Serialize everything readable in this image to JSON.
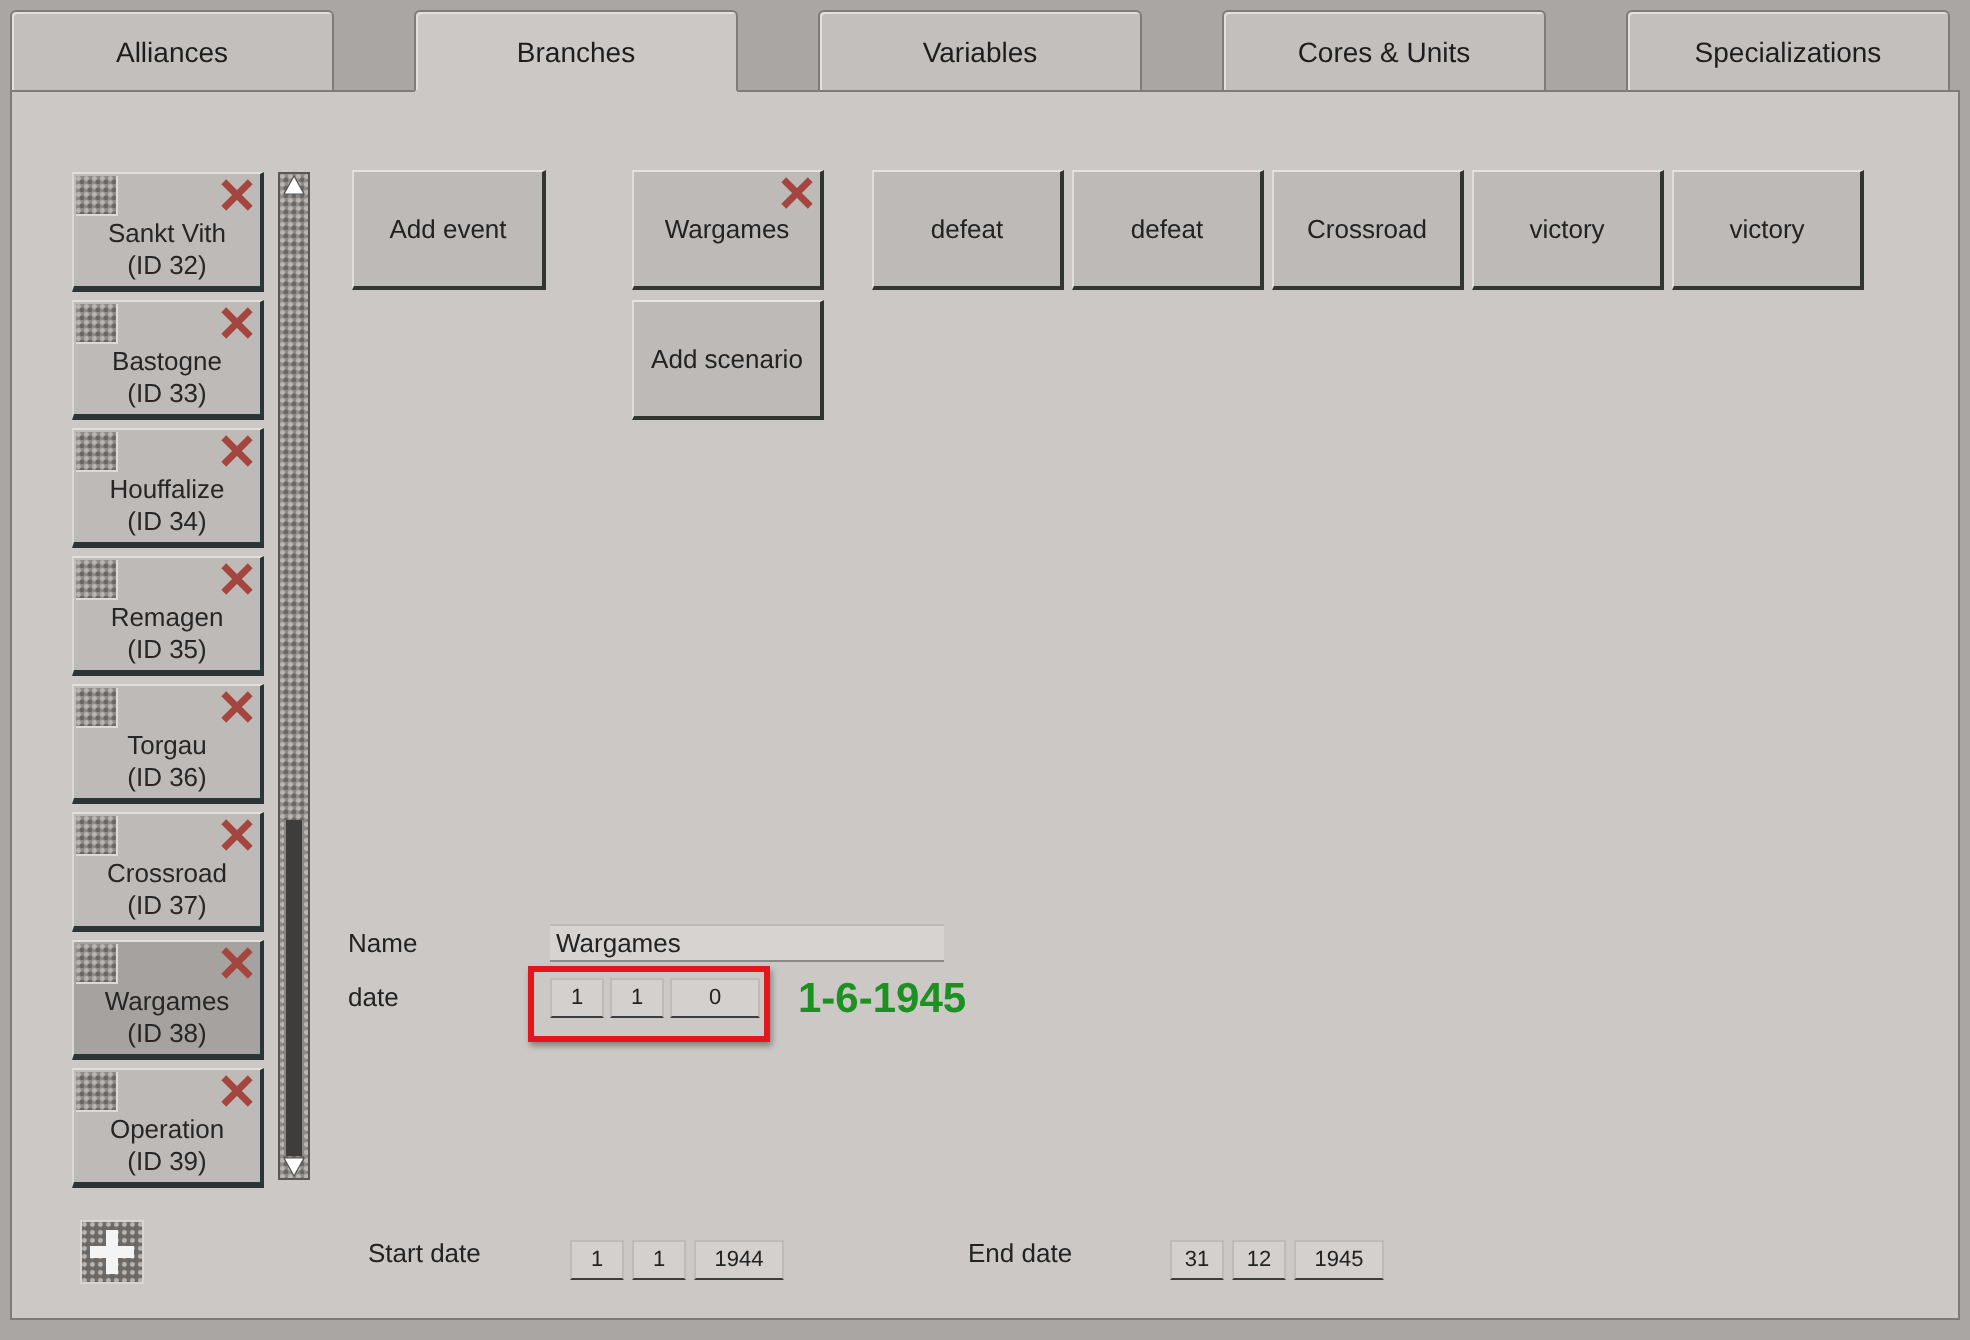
{
  "tabs": [
    {
      "label": "Alliances",
      "selected": false
    },
    {
      "label": "Branches",
      "selected": true
    },
    {
      "label": "Variables",
      "selected": false
    },
    {
      "label": "Cores & Units",
      "selected": false
    },
    {
      "label": "Specializations",
      "selected": false
    }
  ],
  "scenario_list": [
    {
      "name": "Sankt Vith",
      "id": "(ID 32)",
      "selected": false
    },
    {
      "name": "Bastogne",
      "id": "(ID 33)",
      "selected": false
    },
    {
      "name": "Houffalize",
      "id": "(ID 34)",
      "selected": false
    },
    {
      "name": "Remagen",
      "id": "(ID 35)",
      "selected": false
    },
    {
      "name": "Torgau",
      "id": "(ID 36)",
      "selected": false
    },
    {
      "name": "Crossroad",
      "id": "(ID 37)",
      "selected": false
    },
    {
      "name": "Wargames",
      "id": "(ID 38)",
      "selected": true
    },
    {
      "name": "Operation",
      "id": "(ID 39)",
      "selected": false
    }
  ],
  "toolbar": {
    "add_event": "Add event",
    "scenario_buttons": [
      {
        "kind": "scenario",
        "label": "Wargames"
      },
      {
        "kind": "add",
        "label": "Add scenario"
      }
    ],
    "outcomes": [
      "defeat",
      "defeat",
      "Crossroad",
      "victory",
      "victory"
    ]
  },
  "details": {
    "name_label": "Name",
    "name_value": "Wargames",
    "date_label": "date",
    "date_fields": [
      "1",
      "1",
      "0"
    ],
    "date_highlighted": true,
    "date_note": "1-6-1945"
  },
  "footer": {
    "start_label": "Start date",
    "start_fields": [
      "1",
      "1",
      "1944"
    ],
    "end_label": "End date",
    "end_fields": [
      "31",
      "12",
      "1945"
    ]
  }
}
